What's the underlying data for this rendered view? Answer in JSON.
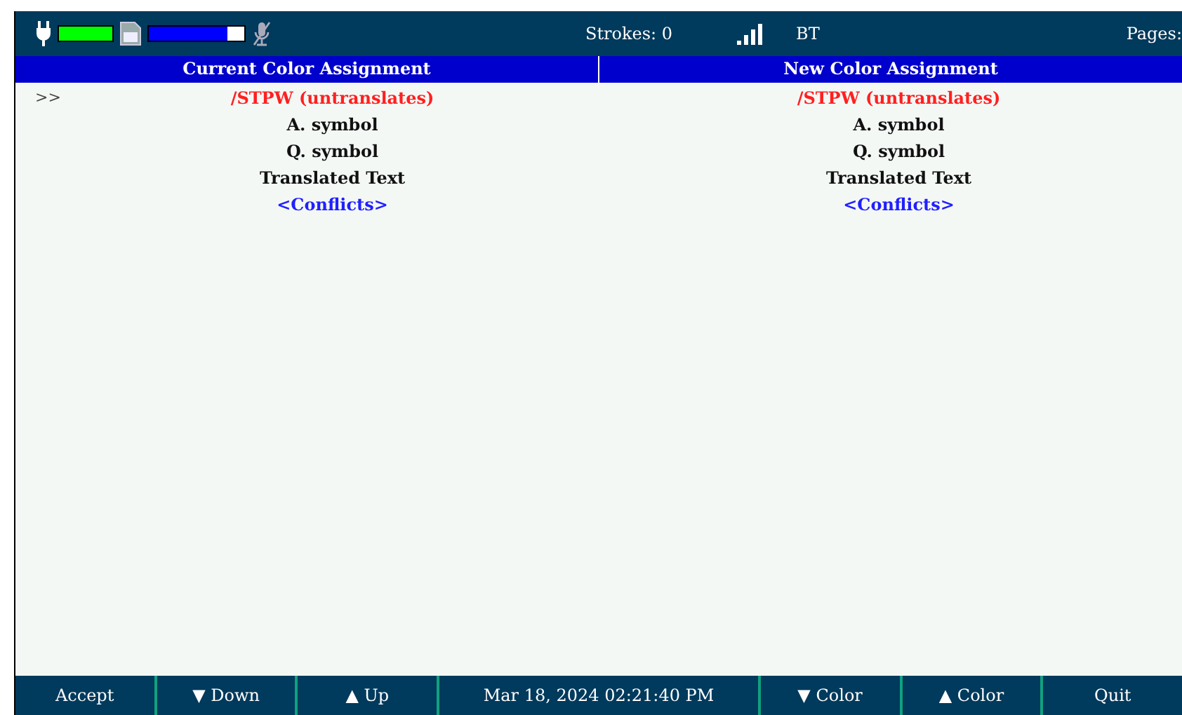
{
  "status_bar": {
    "battery": {
      "level": 1
    },
    "storage": {
      "level": 0.83
    },
    "strokes": "Strokes: 0",
    "bluetooth": "BT",
    "pages": "Pages:"
  },
  "columns": [
    {
      "title": "Current Color Assignment"
    },
    {
      "title": "New Color Assignment"
    }
  ],
  "cursor": ">>",
  "rows": [
    {
      "current": "/STPW (untranslates)",
      "new": "/STPW (untranslates)",
      "color": "#ff2020",
      "selected": true
    },
    {
      "current": "A. symbol",
      "new": "A. symbol",
      "color": "#111111",
      "selected": false
    },
    {
      "current": "Q. symbol",
      "new": "Q. symbol",
      "color": "#111111",
      "selected": false
    },
    {
      "current": "Translated Text",
      "new": "Translated Text",
      "color": "#111111",
      "selected": false
    },
    {
      "current": "<Conflicts>",
      "new": "<Conflicts>",
      "color": "#2020ff",
      "selected": false
    }
  ],
  "softkeys": [
    {
      "kind": "button",
      "label": "Accept"
    },
    {
      "kind": "button",
      "label": "▼ Down"
    },
    {
      "kind": "button",
      "label": "▲ Up"
    },
    {
      "kind": "clock",
      "label": "Mar 18, 2024  02:21:40 PM"
    },
    {
      "kind": "button",
      "label": "▼ Color"
    },
    {
      "kind": "button",
      "label": "▲ Color"
    },
    {
      "kind": "button",
      "label": "Quit"
    }
  ]
}
